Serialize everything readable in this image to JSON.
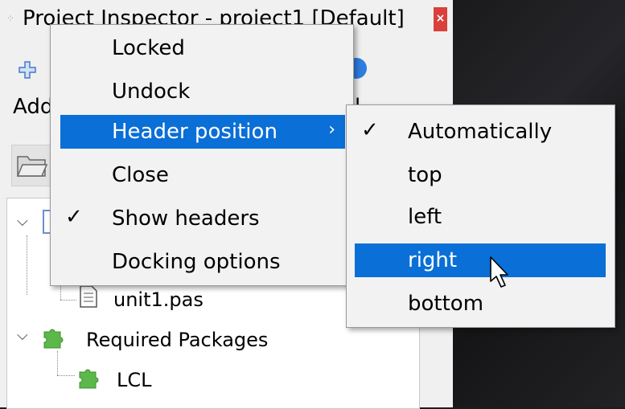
{
  "window": {
    "title": "Project Inspector - project1 [Default]",
    "close_glyph": "×"
  },
  "toolbar": {
    "add_label": "Add",
    "trailing_label": "l"
  },
  "tree": {
    "items": [
      {
        "label": "unit1.pas",
        "icon": "file-icon"
      },
      {
        "label": "Required Packages",
        "icon": "package-icon"
      },
      {
        "label": "LCL",
        "icon": "package-icon"
      }
    ]
  },
  "context_menu": {
    "items": [
      {
        "label": "Locked",
        "checked": false
      },
      {
        "label": "Undock",
        "checked": false
      },
      {
        "label": "Header position",
        "checked": false,
        "submenu": true,
        "arrow": "›"
      },
      {
        "label": "Close",
        "checked": false
      },
      {
        "label": "Show headers",
        "checked": true
      },
      {
        "label": "Docking options",
        "checked": false
      }
    ],
    "check_glyph": "✓"
  },
  "submenu": {
    "items": [
      {
        "label": "Automatically",
        "checked": true
      },
      {
        "label": "top",
        "checked": false
      },
      {
        "label": "left",
        "checked": false
      },
      {
        "label": "right",
        "checked": false,
        "hovered": true
      },
      {
        "label": "bottom",
        "checked": false
      }
    ]
  },
  "colors": {
    "highlight": "#0a6fd6",
    "close_red": "#d9403b",
    "package_green": "#5cb84a"
  }
}
